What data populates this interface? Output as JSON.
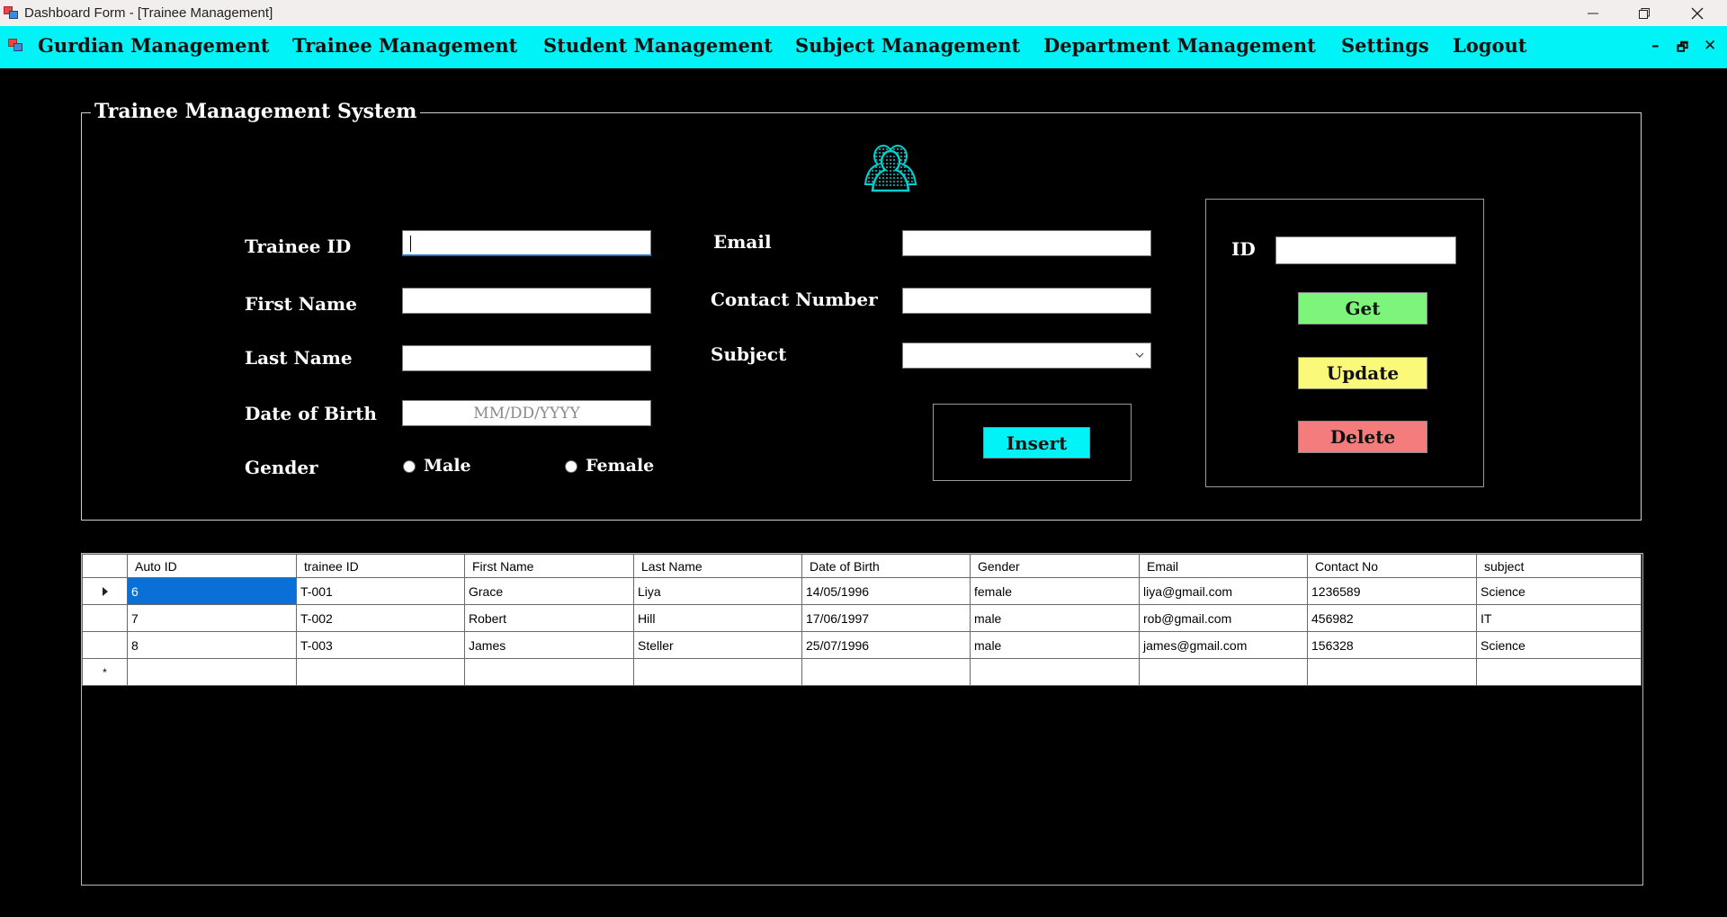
{
  "window": {
    "title": "Dashboard Form - [Trainee Management]"
  },
  "menu": {
    "items": [
      "Gurdian Management",
      "Trainee Management",
      "Student Management",
      "Subject Management",
      "Department Management",
      "Settings",
      "Logout"
    ],
    "mdi_controls": [
      "–",
      "🗗",
      "✕"
    ]
  },
  "form": {
    "group_title": "Trainee Management System",
    "icon": "users-group-icon",
    "labels": {
      "trainee_id": "Trainee ID",
      "first_name": "First Name",
      "last_name": "Last Name",
      "dob": "Date of Birth",
      "gender": "Gender",
      "email": "Email",
      "contact": "Contact Number",
      "subject": "Subject",
      "id": "ID"
    },
    "values": {
      "trainee_id": "",
      "first_name": "",
      "last_name": "",
      "email": "",
      "contact": "",
      "subject": "",
      "id": ""
    },
    "dob_placeholder": "MM/DD/YYYY",
    "gender_options": [
      "Male",
      "Female"
    ],
    "buttons": {
      "insert": "Insert",
      "get": "Get",
      "update": "Update",
      "delete": "Delete"
    },
    "button_colors": {
      "insert": "#00f3f7",
      "get": "#7cf57a",
      "update": "#fbf97a",
      "delete": "#f47c7c"
    },
    "accent_color": "#00f3f7"
  },
  "grid": {
    "columns": [
      "Auto ID",
      "trainee ID",
      "First Name",
      "Last Name",
      "Date of Birth",
      "Gender",
      "Email",
      "Contact No",
      "subject"
    ],
    "rows": [
      [
        "6",
        "T-001",
        "Grace",
        "Liya",
        "14/05/1996",
        "female",
        "liya@gmail.com",
        "1236589",
        "Science"
      ],
      [
        "7",
        "T-002",
        "Robert",
        "Hill",
        "17/06/1997",
        "male",
        "rob@gmail.com",
        "456982",
        "IT"
      ],
      [
        "8",
        "T-003",
        "James",
        "Steller",
        "25/07/1996",
        "male",
        "james@gmail.com",
        "156328",
        "Science"
      ]
    ],
    "new_row_marker": "*",
    "selected_row": 0
  }
}
